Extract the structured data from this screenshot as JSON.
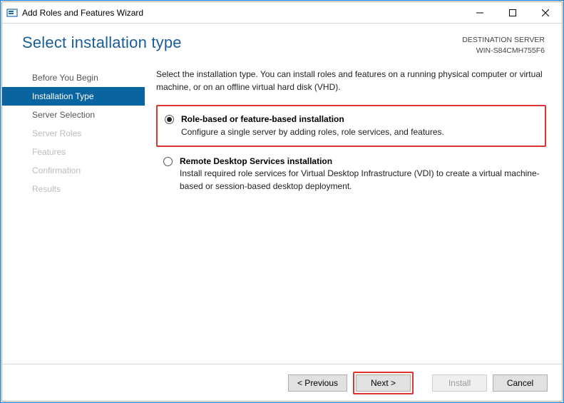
{
  "window": {
    "title": "Add Roles and Features Wizard"
  },
  "header": {
    "heading": "Select installation type",
    "dest_label": "DESTINATION SERVER",
    "dest_value": "WIN-S84CMH755F6"
  },
  "sidebar": {
    "items": [
      {
        "label": "Before You Begin",
        "state": "normal"
      },
      {
        "label": "Installation Type",
        "state": "active"
      },
      {
        "label": "Server Selection",
        "state": "normal"
      },
      {
        "label": "Server Roles",
        "state": "disabled"
      },
      {
        "label": "Features",
        "state": "disabled"
      },
      {
        "label": "Confirmation",
        "state": "disabled"
      },
      {
        "label": "Results",
        "state": "disabled"
      }
    ]
  },
  "main": {
    "intro": "Select the installation type. You can install roles and features on a running physical computer or virtual machine, or on an offline virtual hard disk (VHD).",
    "options": [
      {
        "title": "Role-based or feature-based installation",
        "desc": "Configure a single server by adding roles, role services, and features.",
        "checked": true,
        "highlight": true
      },
      {
        "title": "Remote Desktop Services installation",
        "desc": "Install required role services for Virtual Desktop Infrastructure (VDI) to create a virtual machine-based or session-based desktop deployment.",
        "checked": false,
        "highlight": false
      }
    ]
  },
  "footer": {
    "previous": "< Previous",
    "next": "Next >",
    "install": "Install",
    "cancel": "Cancel"
  }
}
